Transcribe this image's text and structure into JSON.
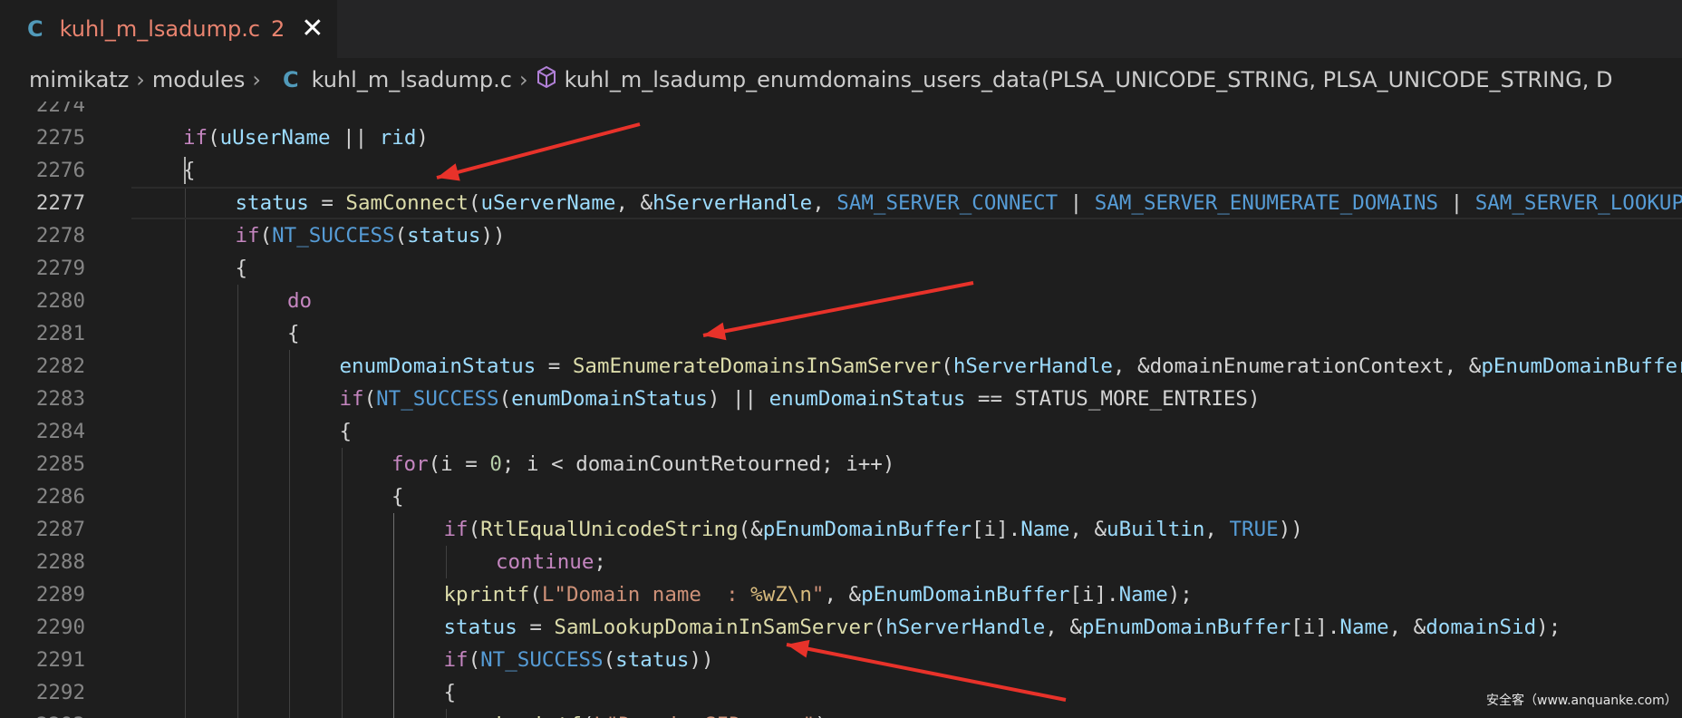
{
  "tab": {
    "icon": "C",
    "filename": "kuhl_m_lsadump.c",
    "problems": "2",
    "close": "✕"
  },
  "breadcrumb": {
    "folder1": "mimikatz",
    "sep": "›",
    "folder2": "modules",
    "file_icon": "C",
    "file": "kuhl_m_lsadump.c",
    "symbol_icon": "cube-icon",
    "symbol": "kuhl_m_lsadump_enumdomains_users_data(PLSA_UNICODE_STRING, PLSA_UNICODE_STRING, D"
  },
  "editor": {
    "active_line": "2277",
    "lines": [
      {
        "n": "2274",
        "indent": 2,
        "t": []
      },
      {
        "n": "2275",
        "indent": 2,
        "t": [
          [
            "kw",
            "if"
          ],
          [
            "pl",
            "("
          ],
          [
            "var",
            "uUserName"
          ],
          [
            "pl",
            " || "
          ],
          [
            "var",
            "rid"
          ],
          [
            "pl",
            ")"
          ]
        ]
      },
      {
        "n": "2276",
        "indent": 2,
        "t": [
          [
            "pl",
            "{"
          ]
        ]
      },
      {
        "n": "2277",
        "indent": 3,
        "t": [
          [
            "var",
            "status"
          ],
          [
            "pl",
            " = "
          ],
          [
            "fn",
            "SamConnect"
          ],
          [
            "pl",
            "("
          ],
          [
            "var",
            "uServerName"
          ],
          [
            "pl",
            ", &"
          ],
          [
            "var",
            "hServerHandle"
          ],
          [
            "pl",
            ", "
          ],
          [
            "mac",
            "SAM_SERVER_CONNECT"
          ],
          [
            "pl",
            " | "
          ],
          [
            "mac",
            "SAM_SERVER_ENUMERATE_DOMAINS"
          ],
          [
            "pl",
            " | "
          ],
          [
            "mac",
            "SAM_SERVER_LOOKUP_DOMAIN"
          ]
        ]
      },
      {
        "n": "2278",
        "indent": 3,
        "t": [
          [
            "kw",
            "if"
          ],
          [
            "pl",
            "("
          ],
          [
            "mac",
            "NT_SUCCESS"
          ],
          [
            "pl",
            "("
          ],
          [
            "var",
            "status"
          ],
          [
            "pl",
            "))"
          ]
        ]
      },
      {
        "n": "2279",
        "indent": 3,
        "t": [
          [
            "pl",
            "{"
          ]
        ]
      },
      {
        "n": "2280",
        "indent": 4,
        "t": [
          [
            "kw",
            "do"
          ]
        ]
      },
      {
        "n": "2281",
        "indent": 4,
        "t": [
          [
            "pl",
            "{"
          ]
        ]
      },
      {
        "n": "2282",
        "indent": 5,
        "t": [
          [
            "var",
            "enumDomainStatus"
          ],
          [
            "pl",
            " = "
          ],
          [
            "fn",
            "SamEnumerateDomainsInSamServer"
          ],
          [
            "pl",
            "("
          ],
          [
            "var",
            "hServerHandle"
          ],
          [
            "pl",
            ", &domainEnumerationContext, &"
          ],
          [
            "var",
            "pEnumDomainBuffer"
          ]
        ]
      },
      {
        "n": "2283",
        "indent": 5,
        "t": [
          [
            "kw",
            "if"
          ],
          [
            "pl",
            "("
          ],
          [
            "mac",
            "NT_SUCCESS"
          ],
          [
            "pl",
            "("
          ],
          [
            "var",
            "enumDomainStatus"
          ],
          [
            "pl",
            ") || "
          ],
          [
            "var",
            "enumDomainStatus"
          ],
          [
            "pl",
            " == STATUS_MORE_ENTRIES)"
          ]
        ]
      },
      {
        "n": "2284",
        "indent": 5,
        "t": [
          [
            "pl",
            "{"
          ]
        ]
      },
      {
        "n": "2285",
        "indent": 6,
        "t": [
          [
            "kw",
            "for"
          ],
          [
            "pl",
            "(i = "
          ],
          [
            "num",
            "0"
          ],
          [
            "pl",
            "; i < domainCountRetourned; i++)"
          ]
        ]
      },
      {
        "n": "2286",
        "indent": 6,
        "t": [
          [
            "pl",
            "{"
          ]
        ]
      },
      {
        "n": "2287",
        "indent": 7,
        "t": [
          [
            "kw",
            "if"
          ],
          [
            "pl",
            "("
          ],
          [
            "fn",
            "RtlEqualUnicodeString"
          ],
          [
            "pl",
            "(&"
          ],
          [
            "var",
            "pEnumDomainBuffer"
          ],
          [
            "pl",
            "[i]."
          ],
          [
            "var",
            "Name"
          ],
          [
            "pl",
            ", &"
          ],
          [
            "var",
            "uBuiltin"
          ],
          [
            "pl",
            ", "
          ],
          [
            "mac",
            "TRUE"
          ],
          [
            "pl",
            "))"
          ]
        ]
      },
      {
        "n": "2288",
        "indent": 8,
        "t": [
          [
            "kw",
            "continue"
          ],
          [
            "pl",
            ";"
          ]
        ]
      },
      {
        "n": "2289",
        "indent": 7,
        "t": [
          [
            "fn",
            "kprintf"
          ],
          [
            "pl",
            "("
          ],
          [
            "str",
            "L\"Domain name  : "
          ],
          [
            "esc",
            "%wZ\\n"
          ],
          [
            "str",
            "\""
          ],
          [
            "pl",
            ", &"
          ],
          [
            "var",
            "pEnumDomainBuffer"
          ],
          [
            "pl",
            "[i]."
          ],
          [
            "var",
            "Name"
          ],
          [
            "pl",
            ");"
          ]
        ]
      },
      {
        "n": "2290",
        "indent": 7,
        "t": [
          [
            "var",
            "status"
          ],
          [
            "pl",
            " = "
          ],
          [
            "fn",
            "SamLookupDomainInSamServer"
          ],
          [
            "pl",
            "("
          ],
          [
            "var",
            "hServerHandle"
          ],
          [
            "pl",
            ", &"
          ],
          [
            "var",
            "pEnumDomainBuffer"
          ],
          [
            "pl",
            "[i]."
          ],
          [
            "var",
            "Name"
          ],
          [
            "pl",
            ", &"
          ],
          [
            "var",
            "domainSid"
          ],
          [
            "pl",
            ");"
          ]
        ]
      },
      {
        "n": "2291",
        "indent": 7,
        "t": [
          [
            "kw",
            "if"
          ],
          [
            "pl",
            "("
          ],
          [
            "mac",
            "NT_SUCCESS"
          ],
          [
            "pl",
            "("
          ],
          [
            "var",
            "status"
          ],
          [
            "pl",
            "))"
          ]
        ]
      },
      {
        "n": "2292",
        "indent": 7,
        "t": [
          [
            "pl",
            "{"
          ]
        ]
      },
      {
        "n": "2293",
        "indent": 8,
        "t": [
          [
            "fn",
            "kprintf"
          ],
          [
            "pl",
            "("
          ],
          [
            "str",
            "L\"Domain SID   : \""
          ],
          [
            "pl",
            ");"
          ]
        ]
      }
    ]
  },
  "annotations": {
    "arrow_color": "#e8322a"
  },
  "watermark": "安全客（www.anquanke.com）"
}
